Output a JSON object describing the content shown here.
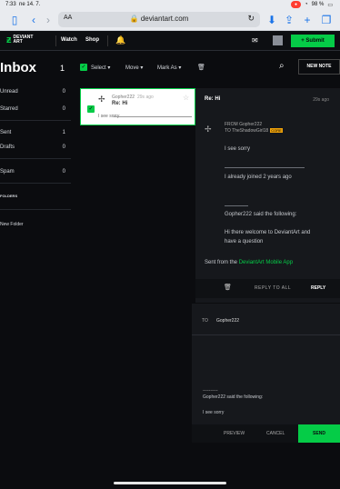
{
  "status_bar": {
    "time": "7:33",
    "date": "ne 14. 7.",
    "battery": "98 %"
  },
  "browser": {
    "font_size_btn": "AA",
    "url": "deviantart.com"
  },
  "header": {
    "logo_line1": "DEVIANT",
    "logo_line2": "ART",
    "nav": [
      "Watch",
      "Shop"
    ],
    "submit_label": "+ Submit"
  },
  "toolbar": {
    "title": "Inbox",
    "count": "1",
    "select": "Select ▾",
    "move": "Move ▾",
    "mark_as": "Mark As ▾",
    "new_note": "NEW NOTE"
  },
  "sidebar": {
    "items": [
      {
        "label": "Unread",
        "count": "0"
      },
      {
        "label": "Starred",
        "count": "0"
      },
      {
        "label": "Sent",
        "count": "1"
      },
      {
        "label": "Drafts",
        "count": "0"
      },
      {
        "label": "Spam",
        "count": "0"
      }
    ],
    "folders_heading": "FOLDERS",
    "new_folder": "New Folder"
  },
  "message": {
    "sender": "Gopher222",
    "time": "29s ago",
    "subject": "Re: Hi",
    "preview": "I see sorry"
  },
  "reader": {
    "subject": "Re: Hi",
    "time": "29s ago",
    "from": "FROM Gopher222",
    "to": "TO TheShadowGirl18",
    "badge": "CORE",
    "lines": [
      "I see sorry",
      "I already joined 2 years ago",
      "Gopher222 said the following:",
      "Hi there welcome to DeviantArt and",
      "have a question"
    ],
    "sent_prefix": "Sent from the ",
    "sent_app": "DeviantArt Mobile App",
    "reply_all": "REPLY TO ALL",
    "reply": "REPLY"
  },
  "compose": {
    "to_label": "TO",
    "to_value": "Gopher222",
    "quote_dash": "----------",
    "quote_said": "Gopher222 said the following:",
    "quote_line": "I see sorry",
    "preview": "PREVIEW",
    "cancel": "CANCEL",
    "send": "SEND"
  },
  "colors": {
    "accent": "#05cc47",
    "background": "#0b0c0f",
    "panel": "#16181c"
  }
}
